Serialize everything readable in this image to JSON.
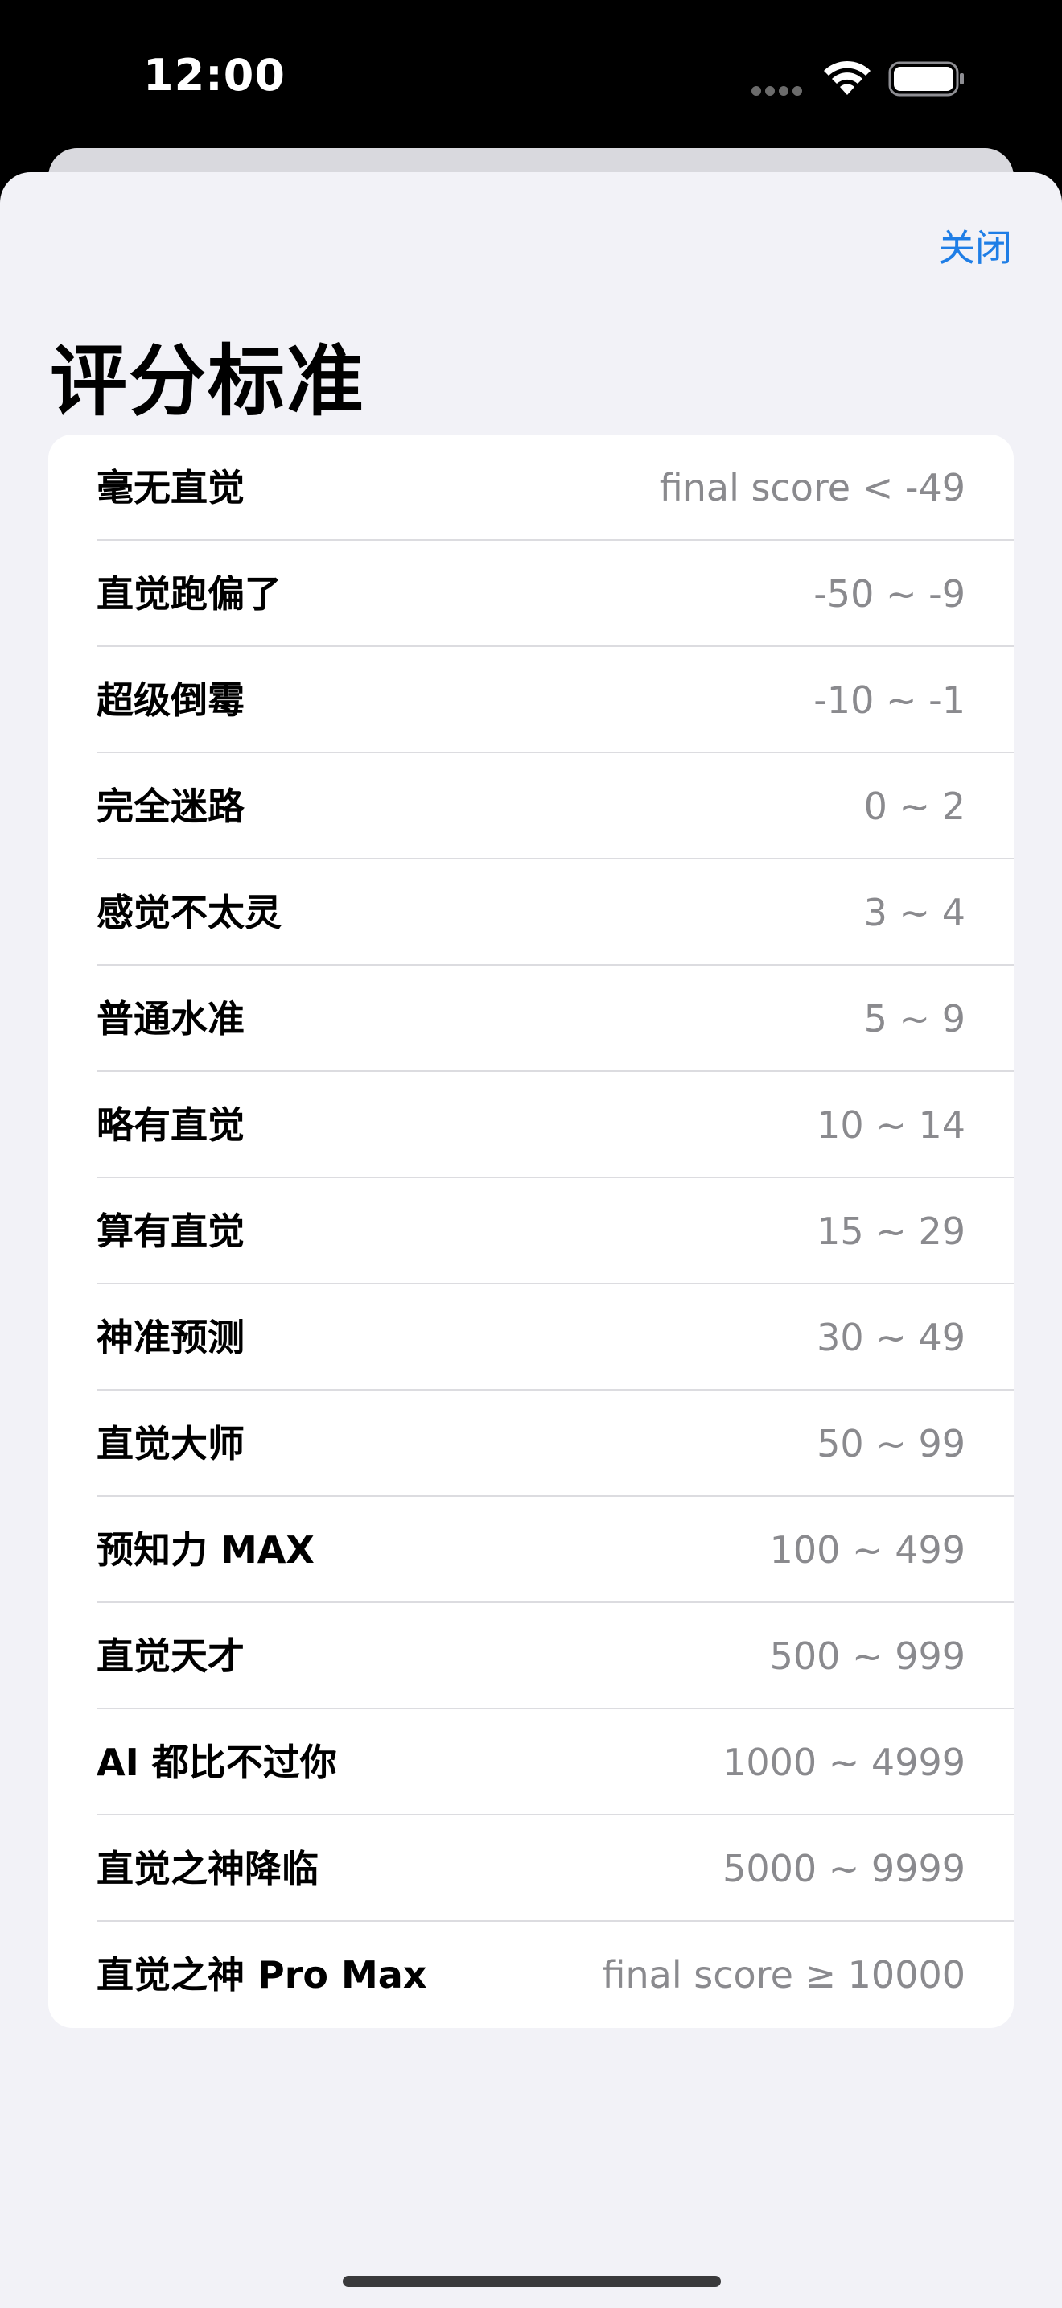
{
  "status_bar": {
    "time": "12:00",
    "icons": [
      "cellular-icon",
      "wifi-icon",
      "battery-icon"
    ]
  },
  "header": {
    "close_label": "关闭",
    "title": "评分标准"
  },
  "criteria": [
    {
      "label": "毫无直觉",
      "range": "final score < -49"
    },
    {
      "label": "直觉跑偏了",
      "range": "-50 ~ -9"
    },
    {
      "label": "超级倒霉",
      "range": "-10 ~ -1"
    },
    {
      "label": "完全迷路",
      "range": "0 ~ 2"
    },
    {
      "label": "感觉不太灵",
      "range": "3 ~ 4"
    },
    {
      "label": "普通水准",
      "range": "5 ~ 9"
    },
    {
      "label": "略有直觉",
      "range": "10 ~ 14"
    },
    {
      "label": "算有直觉",
      "range": "15 ~ 29"
    },
    {
      "label": "神准预测",
      "range": "30 ~ 49"
    },
    {
      "label": "直觉大师",
      "range": "50 ~ 99"
    },
    {
      "label": "预知力 MAX",
      "range": "100 ~ 499"
    },
    {
      "label": "直觉天才",
      "range": "500 ~ 999"
    },
    {
      "label": "AI 都比不过你",
      "range": "1000 ~ 4999"
    },
    {
      "label": "直觉之神降临",
      "range": "5000 ~ 9999"
    },
    {
      "label": "直觉之神 Pro Max",
      "range": "final score ≥ 10000"
    }
  ],
  "colors": {
    "accent": "#1f7ee6",
    "sheet_background": "#f2f2f7",
    "secondary_text": "#8a8a8e"
  }
}
